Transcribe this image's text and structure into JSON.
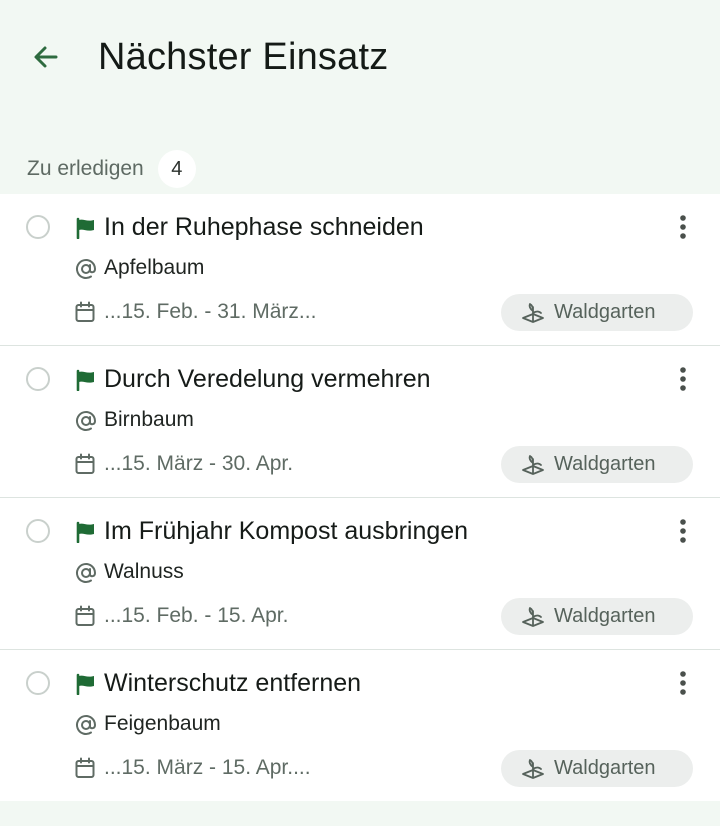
{
  "header": {
    "title": "Nächster Einsatz",
    "back_icon": "arrow-left-icon"
  },
  "section": {
    "label": "Zu erledigen",
    "count": "4"
  },
  "tasks": [
    {
      "title": "In der Ruhephase schneiden",
      "plant": "Apfelbaum",
      "date_range": "...15. Feb. - 31. März...",
      "garden": "Waldgarten"
    },
    {
      "title": "Durch Veredelung vermehren",
      "plant": "Birnbaum",
      "date_range": "...15. März - 30. Apr.",
      "garden": "Waldgarten"
    },
    {
      "title": "Im Frühjahr Kompost ausbringen",
      "plant": "Walnuss",
      "date_range": "...15. Feb. - 15. Apr.",
      "garden": "Waldgarten"
    },
    {
      "title": "Winterschutz entfernen",
      "plant": "Feigenbaum",
      "date_range": "...15. März - 15. Apr....",
      "garden": "Waldgarten"
    }
  ],
  "colors": {
    "background": "#f2f8f3",
    "accent": "#2e6b3f",
    "flag": "#1f6b35"
  }
}
